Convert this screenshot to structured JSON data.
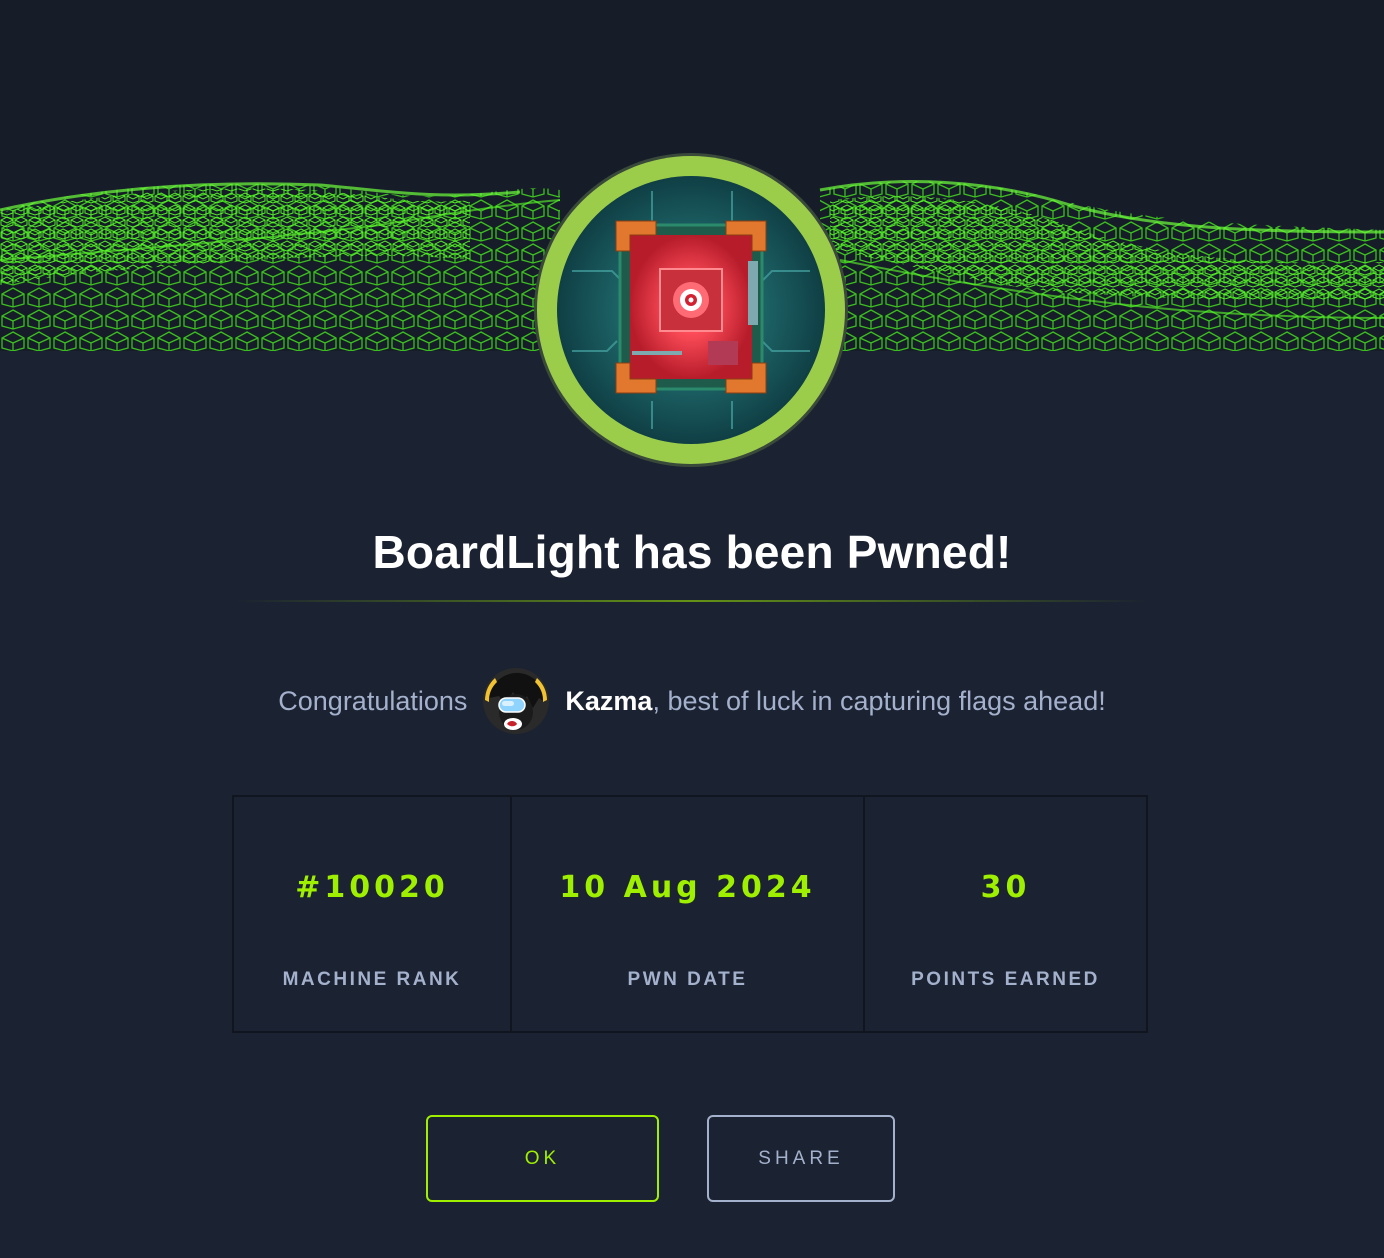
{
  "header": {
    "title": "BoardLight has been Pwned!"
  },
  "congrats": {
    "prefix": "Congratulations",
    "username": "Kazma",
    "suffix": ", best of luck in capturing flags ahead!"
  },
  "stats": [
    {
      "value": "#10020",
      "label": "MACHINE RANK"
    },
    {
      "value": "10 Aug 2024",
      "label": "PWN DATE"
    },
    {
      "value": "30",
      "label": "POINTS EARNED"
    }
  ],
  "buttons": {
    "ok_label": "OK",
    "share_label": "SHARE"
  },
  "colors": {
    "accent": "#9fef00",
    "background": "#1b2231",
    "muted_text": "#a4b1cd",
    "badge_ring": "#9ccd4a"
  },
  "icons": {
    "machine_badge": "circuit-board-icon",
    "user_avatar": "user-avatar"
  }
}
